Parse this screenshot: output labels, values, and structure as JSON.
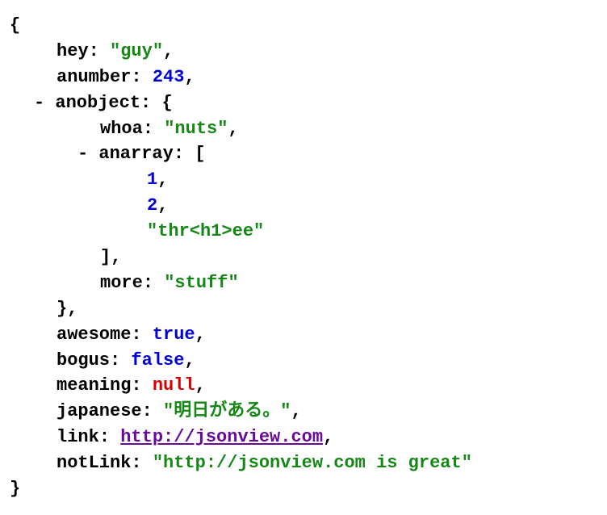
{
  "punct": {
    "obj_open": "{",
    "obj_close": "}",
    "arr_open": "[",
    "arr_close": "]",
    "colon": ":",
    "comma": ",",
    "quote": "\""
  },
  "toggle": {
    "collapse": "-"
  },
  "root": {
    "hey": {
      "key": "hey",
      "value": "guy"
    },
    "anumber": {
      "key": "anumber",
      "value": "243"
    },
    "anobject": {
      "key": "anobject",
      "whoa": {
        "key": "whoa",
        "value": "nuts"
      },
      "anarray": {
        "key": "anarray",
        "items": {
          "0": "1",
          "1": "2",
          "2": "thr<h1>ee"
        }
      },
      "more": {
        "key": "more",
        "value": "stuff"
      }
    },
    "awesome": {
      "key": "awesome",
      "value": "true"
    },
    "bogus": {
      "key": "bogus",
      "value": "false"
    },
    "meaning": {
      "key": "meaning",
      "value": "null"
    },
    "japanese": {
      "key": "japanese",
      "value": "明日がある。"
    },
    "link": {
      "key": "link",
      "value": "http://jsonview.com"
    },
    "notLink": {
      "key": "notLink",
      "value": "http://jsonview.com is great"
    }
  }
}
